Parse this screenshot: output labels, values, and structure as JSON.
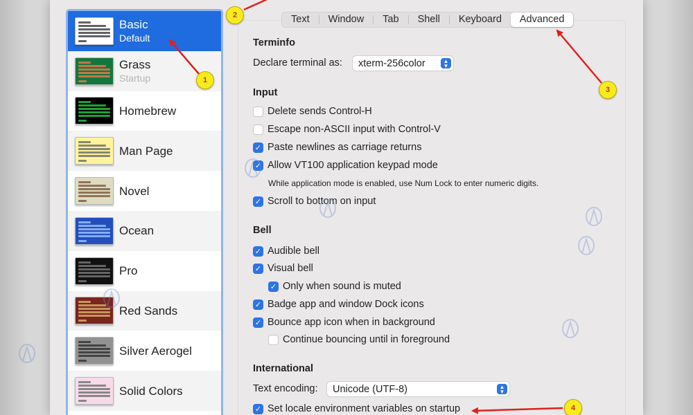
{
  "profiles": [
    {
      "name": "Basic",
      "subtitle": "Default",
      "thumb_bg": "#ffffff",
      "thumb_fg": "#3b3b3b"
    },
    {
      "name": "Grass",
      "subtitle": "Startup",
      "thumb_bg": "#13773d",
      "thumb_fg": "#e87b4e"
    },
    {
      "name": "Homebrew",
      "subtitle": "",
      "thumb_bg": "#000000",
      "thumb_fg": "#28c940"
    },
    {
      "name": "Man Page",
      "subtitle": "",
      "thumb_bg": "#fef49c",
      "thumb_fg": "#6a6a6a"
    },
    {
      "name": "Novel",
      "subtitle": "",
      "thumb_bg": "#dfdbc3",
      "thumb_fg": "#7a5a3a"
    },
    {
      "name": "Ocean",
      "subtitle": "",
      "thumb_bg": "#224fbc",
      "thumb_fg": "#9fc3ff"
    },
    {
      "name": "Pro",
      "subtitle": "",
      "thumb_bg": "#111111",
      "thumb_fg": "#7a7a7a"
    },
    {
      "name": "Red Sands",
      "subtitle": "",
      "thumb_bg": "#7a251e",
      "thumb_fg": "#d9b36a"
    },
    {
      "name": "Silver Aerogel",
      "subtitle": "",
      "thumb_bg": "#929292",
      "thumb_fg": "#2f2f2f"
    },
    {
      "name": "Solid Colors",
      "subtitle": "",
      "thumb_bg": "#f6dbe8",
      "thumb_fg": "#6f6f6f"
    }
  ],
  "tabs": [
    "Text",
    "Window",
    "Tab",
    "Shell",
    "Keyboard",
    "Advanced"
  ],
  "active_tab": "Advanced",
  "terminfo": {
    "title": "Terminfo",
    "declare_label": "Declare terminal as:",
    "declare_value": "xterm-256color"
  },
  "input": {
    "title": "Input",
    "delete_control_h": "Delete sends Control-H",
    "escape_non_ascii": "Escape non-ASCII input with Control-V",
    "paste_newlines": "Paste newlines as carriage returns",
    "allow_vt100": "Allow VT100 application keypad mode",
    "vt100_hint": "While application mode is enabled, use Num Lock to enter numeric digits.",
    "scroll_bottom": "Scroll to bottom on input"
  },
  "bell": {
    "title": "Bell",
    "audible": "Audible bell",
    "visual": "Visual bell",
    "only_muted": "Only when sound is muted",
    "badge": "Badge app and window Dock icons",
    "bounce": "Bounce app icon when in background",
    "continue_bounce": "Continue bouncing until in foreground"
  },
  "international": {
    "title": "International",
    "encoding_label": "Text encoding:",
    "encoding_value": "Unicode (UTF-8)",
    "set_locale": "Set locale environment variables on startup"
  },
  "checkboxes": {
    "delete_control_h": false,
    "escape_non_ascii": false,
    "paste_newlines": true,
    "allow_vt100": true,
    "scroll_bottom": true,
    "audible": true,
    "visual": true,
    "only_muted": true,
    "badge": true,
    "bounce": true,
    "continue_bounce": false,
    "set_locale": true
  },
  "annotations": [
    "1",
    "2",
    "3",
    "4"
  ],
  "colors": {
    "accent": "#2d74e6",
    "selection": "#1f6be0",
    "annotation_arrow": "#e0201b",
    "annotation_badge": "#f7ec1b"
  }
}
